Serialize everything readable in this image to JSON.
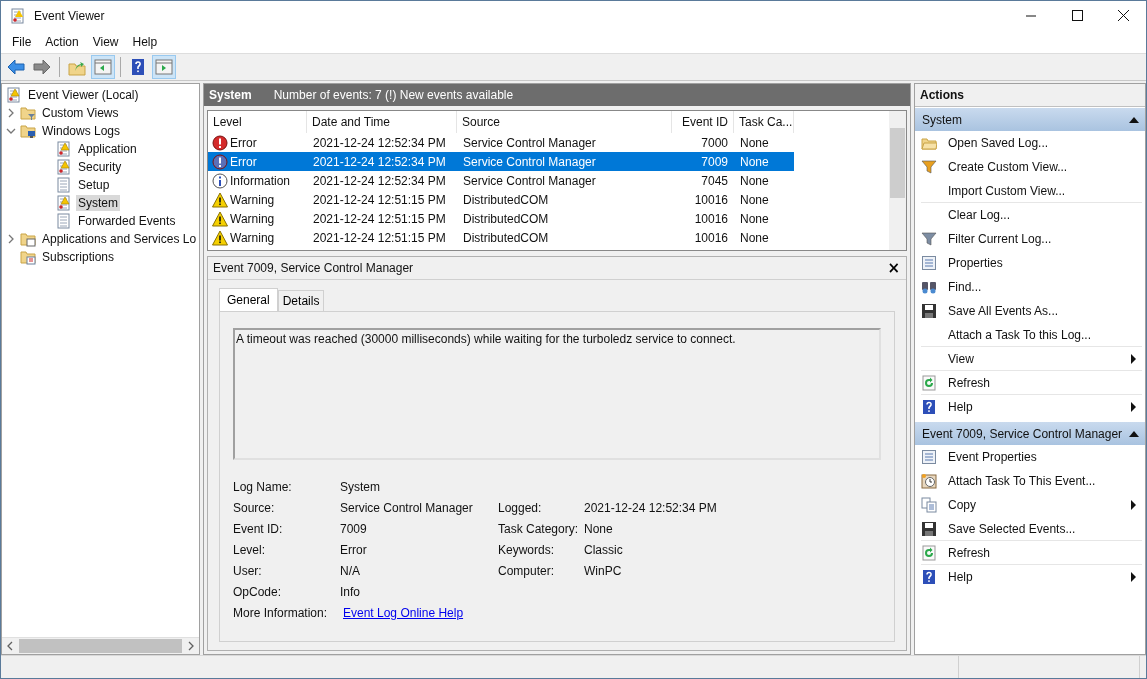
{
  "window": {
    "title": "Event Viewer"
  },
  "menu": [
    "File",
    "Action",
    "View",
    "Help"
  ],
  "toolbar": [
    {
      "kind": "back",
      "pressed": false
    },
    {
      "kind": "forward",
      "pressed": false
    },
    {
      "kind": "up",
      "pressed": false
    },
    {
      "kind": "pane-left",
      "pressed": true
    },
    {
      "kind": "help",
      "pressed": false
    },
    {
      "kind": "pane-right",
      "pressed": true
    }
  ],
  "tree": [
    {
      "label": "Event Viewer (Local)",
      "kind": "log",
      "selected": false,
      "children": [
        {
          "label": "Custom Views",
          "kind": "folder-filter",
          "selected": false,
          "expanded": false
        },
        {
          "label": "Windows Logs",
          "kind": "folder-pc",
          "selected": false,
          "expanded": true,
          "children": [
            {
              "label": "Application",
              "kind": "log",
              "selected": false
            },
            {
              "label": "Security",
              "kind": "log",
              "selected": false
            },
            {
              "label": "Setup",
              "kind": "page",
              "selected": false
            },
            {
              "label": "System",
              "kind": "log",
              "selected": true
            },
            {
              "label": "Forwarded Events",
              "kind": "page",
              "selected": false
            }
          ]
        },
        {
          "label": "Applications and Services Lo",
          "kind": "folder-window",
          "selected": false,
          "expanded": false
        },
        {
          "label": "Subscriptions",
          "kind": "folder-grid",
          "selected": false
        }
      ]
    }
  ],
  "log_header": {
    "title": "System",
    "summary": "Number of events: 7 (!) New events available"
  },
  "table": {
    "columns": [
      "Level",
      "Date and Time",
      "Source",
      "Event ID",
      "Task Ca..."
    ],
    "rows": [
      {
        "kind": "error",
        "level": "Error",
        "date": "2021-12-24 12:52:34 PM",
        "source": "Service Control Manager",
        "event_id": "7000",
        "task": "None",
        "selected": false
      },
      {
        "kind": "error",
        "level": "Error",
        "date": "2021-12-24 12:52:34 PM",
        "source": "Service Control Manager",
        "event_id": "7009",
        "task": "None",
        "selected": true
      },
      {
        "kind": "information",
        "level": "Information",
        "date": "2021-12-24 12:52:34 PM",
        "source": "Service Control Manager",
        "event_id": "7045",
        "task": "None",
        "selected": false
      },
      {
        "kind": "warning",
        "level": "Warning",
        "date": "2021-12-24 12:51:15 PM",
        "source": "DistributedCOM",
        "event_id": "10016",
        "task": "None",
        "selected": false
      },
      {
        "kind": "warning",
        "level": "Warning",
        "date": "2021-12-24 12:51:15 PM",
        "source": "DistributedCOM",
        "event_id": "10016",
        "task": "None",
        "selected": false
      },
      {
        "kind": "warning",
        "level": "Warning",
        "date": "2021-12-24 12:51:15 PM",
        "source": "DistributedCOM",
        "event_id": "10016",
        "task": "None",
        "selected": false
      }
    ]
  },
  "detail": {
    "title": "Event 7009, Service Control Manager",
    "close": "×",
    "tabs": [
      {
        "label": "General",
        "selected": true
      },
      {
        "label": "Details",
        "selected": false
      }
    ],
    "description": "A timeout was reached (30000 milliseconds) while waiting for the turboledz service to connect.",
    "fields_left": [
      {
        "label": "Log Name:",
        "value": "System"
      },
      {
        "label": "Source:",
        "value": "Service Control Manager"
      },
      {
        "label": "Event ID:",
        "value": "7009"
      },
      {
        "label": "Level:",
        "value": "Error"
      },
      {
        "label": "User:",
        "value": "N/A"
      },
      {
        "label": "OpCode:",
        "value": "Info"
      }
    ],
    "fields_right": [
      {
        "label": "Logged:",
        "value": "2021-12-24 12:52:34 PM"
      },
      {
        "label": "Task Category:",
        "value": "None"
      },
      {
        "label": "Keywords:",
        "value": "Classic"
      },
      {
        "label": "Computer:",
        "value": "WinPC"
      }
    ],
    "more_info": {
      "label": "More Information:",
      "link": "Event Log Online Help"
    }
  },
  "actions": {
    "title": "Actions",
    "sections": [
      {
        "title": "System",
        "expanded": true,
        "items": [
          {
            "label": "Open Saved Log...",
            "kind": "folder",
            "submenu": false,
            "separator_after": false
          },
          {
            "label": "Create Custom View...",
            "kind": "funnel-star",
            "submenu": false,
            "separator_after": false
          },
          {
            "label": "Import Custom View...",
            "kind": "none",
            "submenu": false,
            "separator_after": true
          },
          {
            "label": "Clear Log...",
            "kind": "none",
            "submenu": false,
            "separator_after": false
          },
          {
            "label": "Filter Current Log...",
            "kind": "funnel",
            "submenu": false,
            "separator_after": false
          },
          {
            "label": "Properties",
            "kind": "properties",
            "submenu": false,
            "separator_after": false
          },
          {
            "label": "Find...",
            "kind": "binoculars",
            "submenu": false,
            "separator_after": false
          },
          {
            "label": "Save All Events As...",
            "kind": "disk",
            "submenu": false,
            "separator_after": false
          },
          {
            "label": "Attach a Task To this Log...",
            "kind": "none",
            "submenu": false,
            "separator_after": true
          },
          {
            "label": "View",
            "kind": "none",
            "submenu": true,
            "separator_after": true
          },
          {
            "label": "Refresh",
            "kind": "refresh",
            "submenu": false,
            "separator_after": true
          },
          {
            "label": "Help",
            "kind": "help",
            "submenu": true,
            "separator_after": false
          }
        ]
      },
      {
        "title": "Event 7009, Service Control Manager",
        "expanded": true,
        "items": [
          {
            "label": "Event Properties",
            "kind": "properties",
            "submenu": false,
            "separator_after": false
          },
          {
            "label": "Attach Task To This Event...",
            "kind": "clock",
            "submenu": false,
            "separator_after": false
          },
          {
            "label": "Copy",
            "kind": "copy",
            "submenu": true,
            "separator_after": false
          },
          {
            "label": "Save Selected Events...",
            "kind": "disk",
            "submenu": false,
            "separator_after": true
          },
          {
            "label": "Refresh",
            "kind": "refresh",
            "submenu": false,
            "separator_after": true
          },
          {
            "label": "Help",
            "kind": "help",
            "submenu": true,
            "separator_after": false
          }
        ]
      }
    ]
  }
}
